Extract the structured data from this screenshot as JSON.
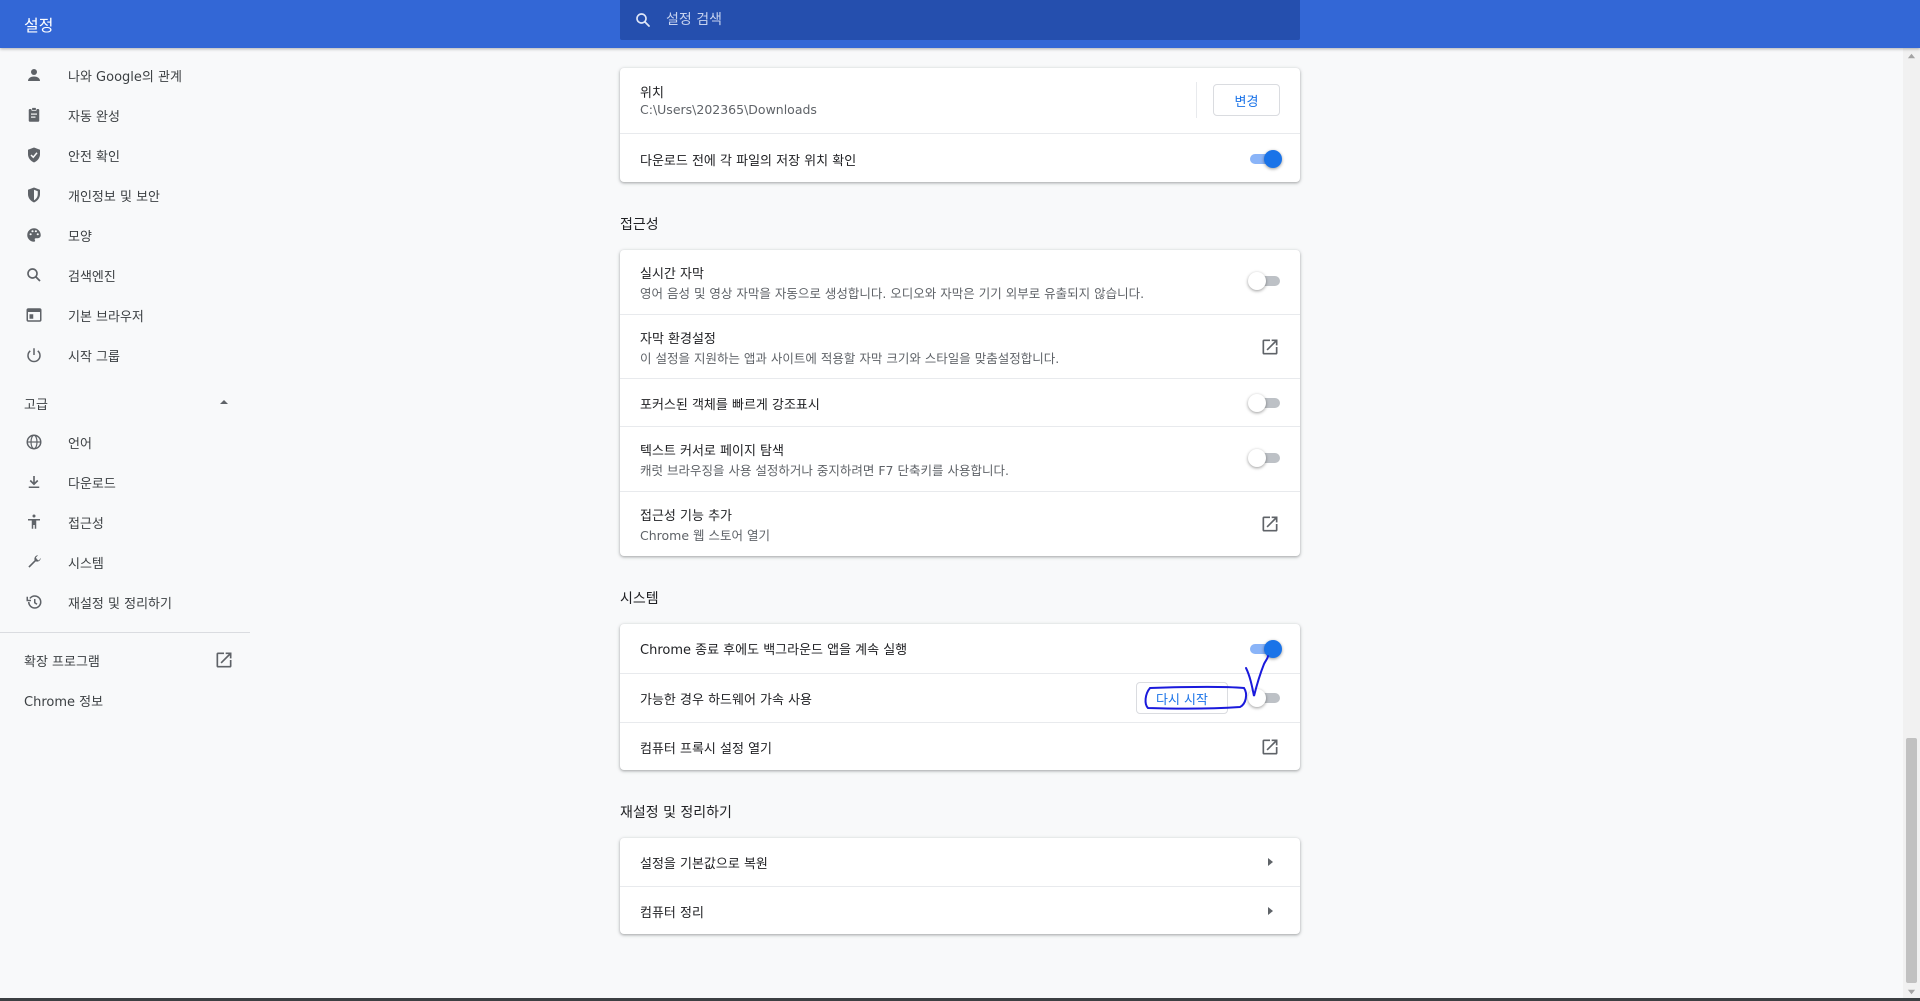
{
  "header": {
    "title": "설정",
    "search_placeholder": "설정 검색"
  },
  "sidebar": {
    "items": [
      {
        "label": "나와 Google의 관계",
        "icon": "person-icon"
      },
      {
        "label": "자동 완성",
        "icon": "clipboard-icon"
      },
      {
        "label": "안전 확인",
        "icon": "shield-check-icon"
      },
      {
        "label": "개인정보 및 보안",
        "icon": "shield-half-icon"
      },
      {
        "label": "모양",
        "icon": "palette-icon"
      },
      {
        "label": "검색엔진",
        "icon": "search-icon"
      },
      {
        "label": "기본 브라우저",
        "icon": "browser-icon"
      },
      {
        "label": "시작 그룹",
        "icon": "power-icon"
      }
    ],
    "advanced_label": "고급",
    "advanced_items": [
      {
        "label": "언어",
        "icon": "globe-icon"
      },
      {
        "label": "다운로드",
        "icon": "download-icon"
      },
      {
        "label": "접근성",
        "icon": "accessibility-icon"
      },
      {
        "label": "시스템",
        "icon": "wrench-icon"
      },
      {
        "label": "재설정 및 정리하기",
        "icon": "history-icon"
      }
    ],
    "extensions_label": "확장 프로그램",
    "about_label": "Chrome 정보"
  },
  "downloads": {
    "location_title": "위치",
    "location_path": "C:\\Users\\202365\\Downloads",
    "change_button": "변경",
    "ask_location_label": "다운로드 전에 각 파일의 저장 위치 확인",
    "ask_location_on": true
  },
  "accessibility": {
    "title": "접근성",
    "live_caption_title": "실시간 자막",
    "live_caption_desc": "영어 음성 및 영상 자막을 자동으로 생성합니다. 오디오와 자막은 기기 외부로 유출되지 않습니다.",
    "live_caption_on": false,
    "caption_prefs_title": "자막 환경설정",
    "caption_prefs_desc": "이 설정을 지원하는 앱과 사이트에 적용할 자막 크기와 스타일을 맞춤설정합니다.",
    "focus_highlight_label": "포커스된 객체를 빠르게 강조표시",
    "focus_highlight_on": false,
    "caret_browsing_title": "텍스트 커서로 페이지 탐색",
    "caret_browsing_desc": "캐럿 브라우징을 사용 설정하거나 중지하려면 F7 단축키를 사용합니다.",
    "caret_browsing_on": false,
    "add_features_title": "접근성 기능 추가",
    "add_features_desc": "Chrome 웹 스토어 열기"
  },
  "system": {
    "title": "시스템",
    "background_apps_label": "Chrome 종료 후에도 백그라운드 앱을 계속 실행",
    "background_apps_on": true,
    "hw_accel_label": "가능한 경우 하드웨어 가속 사용",
    "hw_accel_on": false,
    "relaunch_button": "다시 시작",
    "proxy_label": "컴퓨터 프록시 설정 열기"
  },
  "reset": {
    "title": "재설정 및 정리하기",
    "restore_label": "설정을 기본값으로 복원",
    "cleanup_label": "컴퓨터 정리"
  },
  "colors": {
    "header": "#3367d6",
    "accent": "#1a73e8",
    "annotation_ink": "#1a1adc"
  }
}
